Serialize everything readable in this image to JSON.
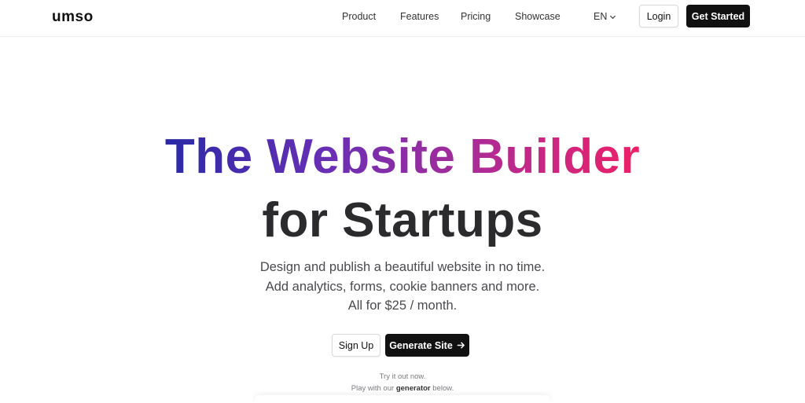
{
  "logo": "umso",
  "nav": {
    "product": "Product",
    "features": "Features",
    "pricing": "Pricing",
    "showcase": "Showcase",
    "language": "EN",
    "login": "Login",
    "get_started": "Get Started"
  },
  "hero": {
    "title_line1": "The Website Builder",
    "title_line2": "for Startups",
    "subtitle_1": "Design and publish a beautiful website in no time.",
    "subtitle_2": "Add analytics, forms, cookie banners and more.",
    "subtitle_3": "All for $25 / month."
  },
  "actions": {
    "sign_up": "Sign Up",
    "generate": "Generate Site"
  },
  "hint": {
    "line1": "Try it out now.",
    "line2_prefix": "Play with our",
    "line2_bold": "generator",
    "line2_suffix": "below."
  },
  "colors": {
    "gradient_start": "#2a2aa6",
    "gradient_mid": "#6a2fb5",
    "gradient_end": "#ee2067",
    "primary_button": "#111111"
  },
  "icons": {
    "language_dropdown": "chevron-down-icon",
    "generate_arrow": "arrow-right-icon"
  }
}
